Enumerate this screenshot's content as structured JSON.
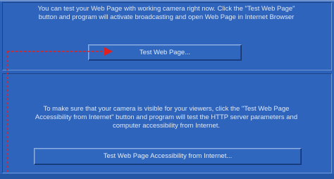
{
  "intro_text_lines": [
    "You can test your Web Page with working camera right now. Click the \"Test Web Page\"",
    "button and program will activate broadcasting and open Web Page in Internet Browser"
  ],
  "test_button_label": "Test Web Page...",
  "accessibility_text_lines": [
    "To make sure that your camera is visible for your viewers, click the \"Test Web Page",
    "Accessibility from Internet\" button and program will test the HTTP server parameters and",
    "computer accessibility from Internet."
  ],
  "accessibility_button_label": "Test Web Page Accessibility from Internet...",
  "colors": {
    "background": "#2c62b9",
    "annotation_arrow": "#e0211f"
  }
}
